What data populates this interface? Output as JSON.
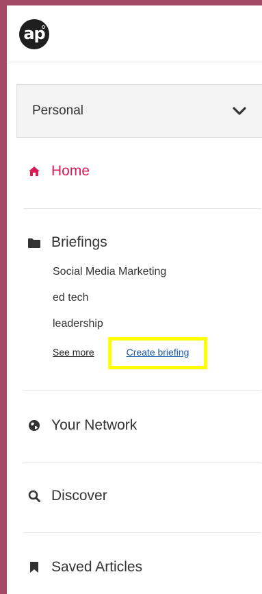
{
  "brand": {
    "logo_text": "ap"
  },
  "account": {
    "selected": "Personal"
  },
  "nav": {
    "home": "Home",
    "briefings": {
      "label": "Briefings",
      "items": [
        "Social Media Marketing",
        "ed tech",
        "leadership"
      ],
      "see_more": "See more",
      "create": "Create briefing"
    },
    "network": "Your Network",
    "discover": "Discover",
    "saved": "Saved Articles"
  },
  "colors": {
    "background": "#a24a66",
    "accent": "#d81b55",
    "link": "#1a5aa6",
    "highlight": "#ffff00"
  },
  "icons": {
    "home": "home-icon",
    "briefings": "folder-icon",
    "network": "globe-icon",
    "discover": "search-icon",
    "saved": "bookmark-icon",
    "account": "chevron-down-icon"
  }
}
